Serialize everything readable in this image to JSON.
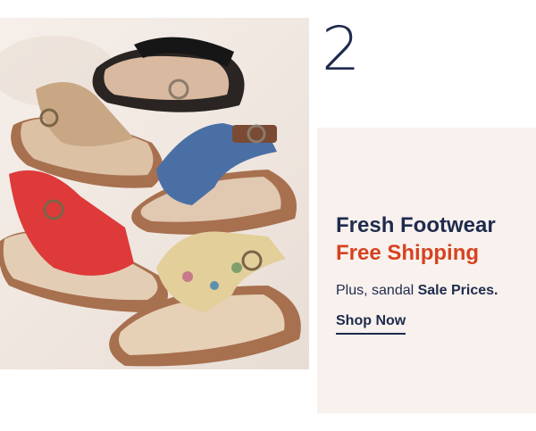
{
  "promo": {
    "step_number": "2",
    "headline": "Fresh Footwear",
    "subhead": "Free Shipping",
    "body_prefix": "Plus, sandal ",
    "body_emphasis": "Sale Prices.",
    "cta_label": "Shop Now"
  },
  "image": {
    "description_icon": "sandals-photo",
    "sandal_colors": [
      "#1b1b1b",
      "#c9a784",
      "#4a6fa5",
      "#de3a3a",
      "#e3cf9a"
    ]
  },
  "colors": {
    "navy": "#1f2b4d",
    "accent": "#d6431f",
    "panel": "#f8f1ee"
  }
}
